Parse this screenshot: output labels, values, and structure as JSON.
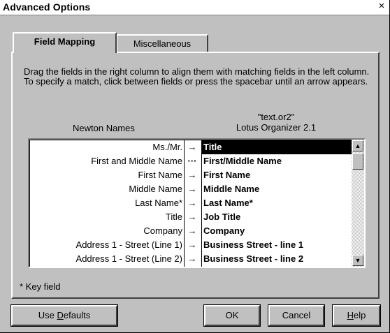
{
  "window": {
    "title": "Advanced Options",
    "close_glyph": "×"
  },
  "tabs": [
    {
      "label": "Field Mapping",
      "active": true
    },
    {
      "label": "Miscellaneous",
      "active": false
    }
  ],
  "instructions": "Drag the fields in the right column to align them with matching fields in the left column.  To specify a match, click between fields or press the spacebar until an arrow appears.",
  "columns": {
    "left_header": "Newton Names",
    "right_header_line1": "\"text.or2\"",
    "right_header_line2": "Lotus Organizer 2.1"
  },
  "mappings": [
    {
      "left": "Ms./Mr.",
      "sep": "→",
      "right": "Title",
      "selected": true
    },
    {
      "left": "First and Middle Name",
      "sep": "···",
      "right": "First/Middle Name",
      "selected": false
    },
    {
      "left": "First Name",
      "sep": "→",
      "right": "First Name",
      "selected": false
    },
    {
      "left": "Middle Name",
      "sep": "→",
      "right": "Middle Name",
      "selected": false
    },
    {
      "left": "Last Name*",
      "sep": "→",
      "right": "Last Name*",
      "selected": false
    },
    {
      "left": "Title",
      "sep": "→",
      "right": "Job Title",
      "selected": false
    },
    {
      "left": "Company",
      "sep": "→",
      "right": "Company",
      "selected": false
    },
    {
      "left": "Address 1 - Street (Line 1)",
      "sep": "→",
      "right": "Business Street - line 1",
      "selected": false
    },
    {
      "left": "Address 1 - Street (Line 2)",
      "sep": "→",
      "right": "Business Street - line 2",
      "selected": false
    }
  ],
  "scrollbar": {
    "up_icon": "▲",
    "down_icon": "▼"
  },
  "key_note": "* Key field",
  "buttons": {
    "use_defaults_pre": "Use ",
    "use_defaults_mnemonic": "D",
    "use_defaults_post": "efaults",
    "ok": "OK",
    "cancel": "Cancel",
    "help_mnemonic": "H",
    "help_post": "elp"
  }
}
